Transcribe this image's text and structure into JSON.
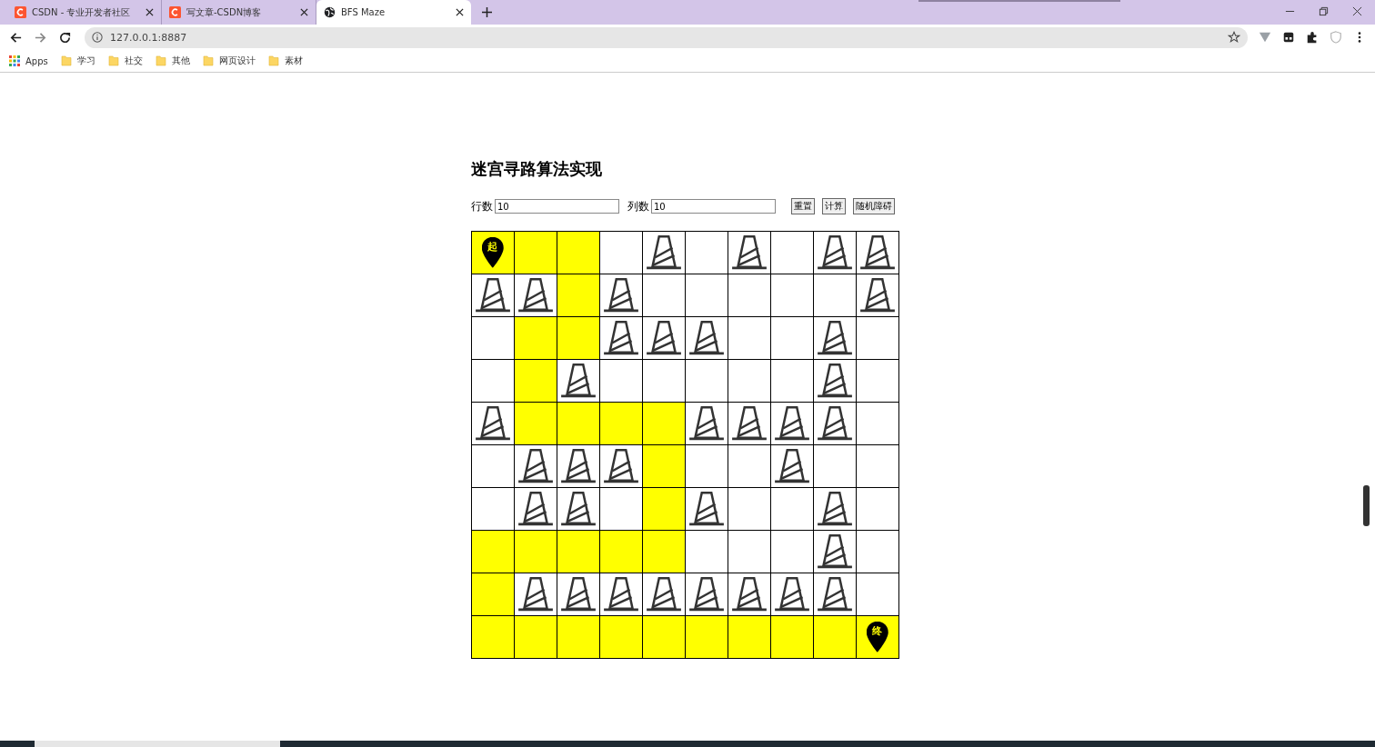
{
  "tabs": [
    {
      "title": "CSDN - 专业开发者社区",
      "kind": "csdn",
      "selected": false
    },
    {
      "title": "写文章-CSDN博客",
      "kind": "csdn",
      "selected": false
    },
    {
      "title": "BFS Maze",
      "kind": "local",
      "selected": true
    }
  ],
  "address_bar": {
    "url": "127.0.0.1:8887"
  },
  "bookmarks": [
    {
      "label": "Apps",
      "kind": "apps"
    },
    {
      "label": "学习",
      "kind": "folder"
    },
    {
      "label": "社交",
      "kind": "folder"
    },
    {
      "label": "其他",
      "kind": "folder"
    },
    {
      "label": "网页设计",
      "kind": "folder"
    },
    {
      "label": "素材",
      "kind": "folder"
    }
  ],
  "page": {
    "title": "迷宫寻路算法实现",
    "fields": [
      {
        "label": "行数",
        "value": "10"
      },
      {
        "label": "列数",
        "value": "10"
      }
    ],
    "buttons": [
      "重置",
      "计算",
      "随机障碍"
    ],
    "grid": [
      [
        {
          "kind": "start",
          "label": "起"
        },
        {
          "kind": "path"
        },
        {
          "kind": "path"
        },
        {
          "kind": "empty"
        },
        {
          "kind": "wall"
        },
        {
          "kind": "empty"
        },
        {
          "kind": "wall"
        },
        {
          "kind": "empty"
        },
        {
          "kind": "wall"
        },
        {
          "kind": "wall"
        }
      ],
      [
        {
          "kind": "wall"
        },
        {
          "kind": "wall"
        },
        {
          "kind": "path"
        },
        {
          "kind": "wall"
        },
        {
          "kind": "empty"
        },
        {
          "kind": "empty"
        },
        {
          "kind": "empty"
        },
        {
          "kind": "empty"
        },
        {
          "kind": "empty"
        },
        {
          "kind": "wall"
        }
      ],
      [
        {
          "kind": "empty"
        },
        {
          "kind": "path"
        },
        {
          "kind": "path"
        },
        {
          "kind": "wall"
        },
        {
          "kind": "wall"
        },
        {
          "kind": "wall"
        },
        {
          "kind": "empty"
        },
        {
          "kind": "empty"
        },
        {
          "kind": "wall"
        },
        {
          "kind": "empty"
        }
      ],
      [
        {
          "kind": "empty"
        },
        {
          "kind": "path"
        },
        {
          "kind": "wall"
        },
        {
          "kind": "empty"
        },
        {
          "kind": "empty"
        },
        {
          "kind": "empty"
        },
        {
          "kind": "empty"
        },
        {
          "kind": "empty"
        },
        {
          "kind": "wall"
        },
        {
          "kind": "empty"
        }
      ],
      [
        {
          "kind": "wall"
        },
        {
          "kind": "path"
        },
        {
          "kind": "path"
        },
        {
          "kind": "path"
        },
        {
          "kind": "path"
        },
        {
          "kind": "wall"
        },
        {
          "kind": "wall"
        },
        {
          "kind": "wall"
        },
        {
          "kind": "wall"
        },
        {
          "kind": "empty"
        }
      ],
      [
        {
          "kind": "empty"
        },
        {
          "kind": "wall"
        },
        {
          "kind": "wall"
        },
        {
          "kind": "wall"
        },
        {
          "kind": "path"
        },
        {
          "kind": "empty"
        },
        {
          "kind": "empty"
        },
        {
          "kind": "wall"
        },
        {
          "kind": "empty"
        },
        {
          "kind": "empty"
        }
      ],
      [
        {
          "kind": "empty"
        },
        {
          "kind": "wall"
        },
        {
          "kind": "wall"
        },
        {
          "kind": "empty"
        },
        {
          "kind": "path"
        },
        {
          "kind": "wall"
        },
        {
          "kind": "empty"
        },
        {
          "kind": "empty"
        },
        {
          "kind": "wall"
        },
        {
          "kind": "empty"
        }
      ],
      [
        {
          "kind": "path"
        },
        {
          "kind": "path"
        },
        {
          "kind": "path"
        },
        {
          "kind": "path"
        },
        {
          "kind": "path"
        },
        {
          "kind": "empty"
        },
        {
          "kind": "empty"
        },
        {
          "kind": "empty"
        },
        {
          "kind": "wall"
        },
        {
          "kind": "empty"
        }
      ],
      [
        {
          "kind": "path"
        },
        {
          "kind": "wall"
        },
        {
          "kind": "wall"
        },
        {
          "kind": "wall"
        },
        {
          "kind": "wall"
        },
        {
          "kind": "wall"
        },
        {
          "kind": "wall"
        },
        {
          "kind": "wall"
        },
        {
          "kind": "wall"
        },
        {
          "kind": "empty"
        }
      ],
      [
        {
          "kind": "path"
        },
        {
          "kind": "path"
        },
        {
          "kind": "path"
        },
        {
          "kind": "path"
        },
        {
          "kind": "path"
        },
        {
          "kind": "path"
        },
        {
          "kind": "path"
        },
        {
          "kind": "path"
        },
        {
          "kind": "path"
        },
        {
          "kind": "end",
          "label": "终"
        }
      ]
    ]
  }
}
